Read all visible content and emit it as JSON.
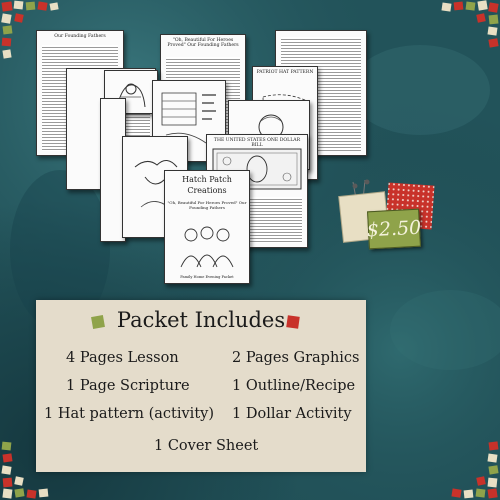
{
  "pages": {
    "founding_fathers_head": "Our Founding Fathers",
    "oh_beautiful_head": "\"Oh, Beautiful For Heroes Proved\" Our Founding Fathers",
    "patriot_hat_head": "PATRIOT HAT PATTERN",
    "dollar_head": "THE UNITED STATES ONE DOLLAR BILL",
    "scripture_text": "\"Therefore, it is not right that any man should be in bondage one to another. And for this purpose have I established",
    "brand_line1": "Hatch Patch",
    "brand_line2": "Creations",
    "cover_subtitle": "\"Oh, Beautiful For Heroes Proved\" Our Founding Fathers",
    "cover_small": "Family Home Evening Packet"
  },
  "price": {
    "label": "$2.50"
  },
  "packet": {
    "title": "Packet Includes",
    "items": [
      "4 Pages Lesson",
      "2 Pages Graphics",
      "1 Page Scripture",
      "1 Outline/Recipe",
      "1 Hat pattern (activity)",
      "1 Dollar Activity",
      "1 Cover Sheet"
    ]
  },
  "colors": {
    "background": "#1f4d54",
    "panel": "#e4dccb",
    "green_square": "#8fa34a",
    "red_square": "#c8322a",
    "price_tag": "#8fa34a"
  }
}
